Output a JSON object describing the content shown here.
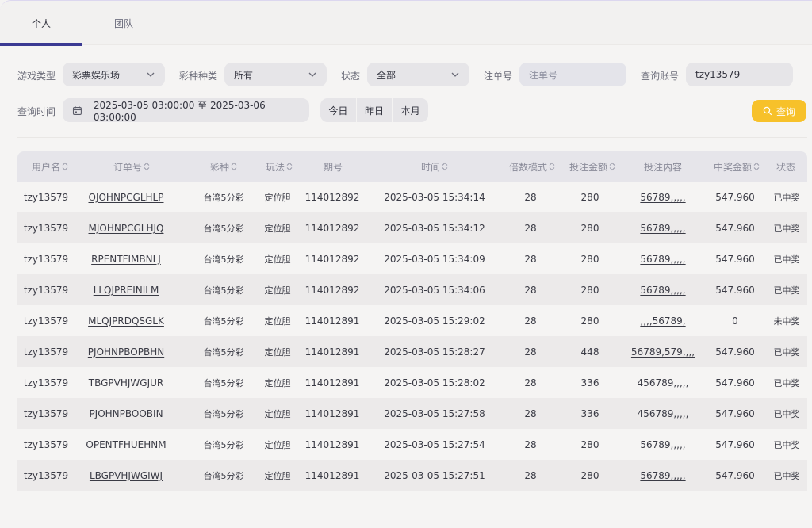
{
  "tabs": [
    {
      "label": "个人",
      "active": true
    },
    {
      "label": "团队",
      "active": false
    }
  ],
  "filters": {
    "game_type": {
      "label": "游戏类型",
      "value": "彩票娱乐场"
    },
    "lottery_type": {
      "label": "彩种种类",
      "value": "所有"
    },
    "status": {
      "label": "状态",
      "value": "全部"
    },
    "order_no": {
      "label": "注单号",
      "placeholder": "注单号"
    },
    "account": {
      "label": "查询账号",
      "value": "tzy13579"
    },
    "time": {
      "label": "查询时间",
      "value": "2025-03-05 03:00:00 至 2025-03-06 03:00:00"
    },
    "quick": [
      "今日",
      "昨日",
      "本月"
    ],
    "query_button": "查询"
  },
  "table": {
    "columns": [
      "用户名",
      "订单号",
      "彩种",
      "玩法",
      "期号",
      "时间",
      "倍数模式",
      "投注金额",
      "投注内容",
      "中奖金额",
      "状态"
    ],
    "rows": [
      [
        "tzy13579",
        "OJOHNPCGLHLP",
        "台湾5分彩",
        "定位胆",
        "114012892",
        "2025-03-05 15:34:14",
        "28",
        "280",
        "56789,,,,,",
        "547.960",
        "已中奖"
      ],
      [
        "tzy13579",
        "MJOHNPCGLHJQ",
        "台湾5分彩",
        "定位胆",
        "114012892",
        "2025-03-05 15:34:12",
        "28",
        "280",
        "56789,,,,,",
        "547.960",
        "已中奖"
      ],
      [
        "tzy13579",
        "RPENTFIMBNLJ",
        "台湾5分彩",
        "定位胆",
        "114012892",
        "2025-03-05 15:34:09",
        "28",
        "280",
        "56789,,,,,",
        "547.960",
        "已中奖"
      ],
      [
        "tzy13579",
        "LLQJPREINILM",
        "台湾5分彩",
        "定位胆",
        "114012892",
        "2025-03-05 15:34:06",
        "28",
        "280",
        "56789,,,,,",
        "547.960",
        "已中奖"
      ],
      [
        "tzy13579",
        "MLQJPRDQSGLK",
        "台湾5分彩",
        "定位胆",
        "114012891",
        "2025-03-05 15:29:02",
        "28",
        "280",
        ",,,,56789,",
        "0",
        "未中奖"
      ],
      [
        "tzy13579",
        "PJOHNPBOPBHN",
        "台湾5分彩",
        "定位胆",
        "114012891",
        "2025-03-05 15:28:27",
        "28",
        "448",
        "56789,579,,,,",
        "547.960",
        "已中奖"
      ],
      [
        "tzy13579",
        "TBGPVHJWGJUR",
        "台湾5分彩",
        "定位胆",
        "114012891",
        "2025-03-05 15:28:02",
        "28",
        "336",
        "456789,,,,,",
        "547.960",
        "已中奖"
      ],
      [
        "tzy13579",
        "PJOHNPBOOBIN",
        "台湾5分彩",
        "定位胆",
        "114012891",
        "2025-03-05 15:27:58",
        "28",
        "336",
        "456789,,,,,",
        "547.960",
        "已中奖"
      ],
      [
        "tzy13579",
        "OPENTFHUEHNM",
        "台湾5分彩",
        "定位胆",
        "114012891",
        "2025-03-05 15:27:54",
        "28",
        "280",
        "56789,,,,,",
        "547.960",
        "已中奖"
      ],
      [
        "tzy13579",
        "LBGPVHJWGIWJ",
        "台湾5分彩",
        "定位胆",
        "114012891",
        "2025-03-05 15:27:51",
        "28",
        "280",
        "56789,,,,,",
        "547.960",
        "已中奖"
      ]
    ]
  },
  "colors": {
    "accent": "#3b3a93",
    "query_button": "#f7c12a"
  }
}
